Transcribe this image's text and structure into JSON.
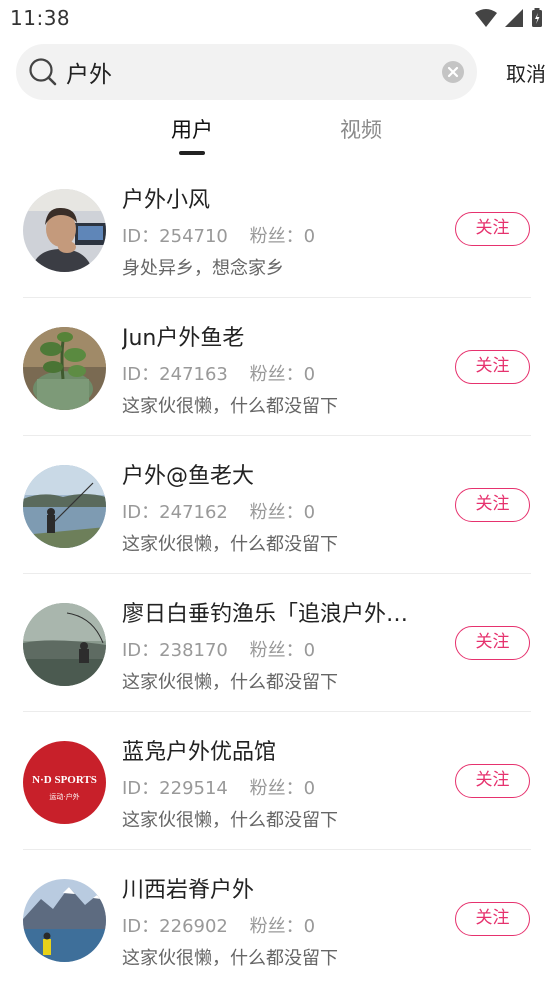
{
  "status_bar": {
    "time": "11:38"
  },
  "search": {
    "query": "户外",
    "cancel_label": "取消"
  },
  "tabs": [
    {
      "label": "用户",
      "active": true
    },
    {
      "label": "视频",
      "active": false
    }
  ],
  "users": [
    {
      "name": "户外小风",
      "id_label": "ID：",
      "id": "254710",
      "fans_label": "粉丝：",
      "fans": "0",
      "bio": "身处异乡，想念家乡",
      "follow_label": "关注"
    },
    {
      "name": "Jun户外鱼老",
      "id_label": "ID：",
      "id": "247163",
      "fans_label": "粉丝：",
      "fans": "0",
      "bio": "这家伙很懒，什么都没留下",
      "follow_label": "关注"
    },
    {
      "name": "户外@鱼老大",
      "id_label": "ID：",
      "id": "247162",
      "fans_label": "粉丝：",
      "fans": "0",
      "bio": "这家伙很懒，什么都没留下",
      "follow_label": "关注"
    },
    {
      "name": "廖日白垂钓渔乐「追浪户外…",
      "id_label": "ID：",
      "id": "238170",
      "fans_label": "粉丝：",
      "fans": "0",
      "bio": "这家伙很懒，什么都没留下",
      "follow_label": "关注"
    },
    {
      "name": "蓝凫户外优品馆",
      "id_label": "ID：",
      "id": "229514",
      "fans_label": "粉丝：",
      "fans": "0",
      "bio": "这家伙很懒，什么都没留下",
      "follow_label": "关注",
      "avatar_text": [
        "N·D SPORTS",
        "运动·户外"
      ]
    },
    {
      "name": "川西岩脊户外",
      "id_label": "ID：",
      "id": "226902",
      "fans_label": "粉丝：",
      "fans": "0",
      "bio": "这家伙很懒，什么都没留下",
      "follow_label": "关注"
    }
  ],
  "colors": {
    "accent": "#e6326e",
    "search_bg": "#f2f2f2"
  }
}
